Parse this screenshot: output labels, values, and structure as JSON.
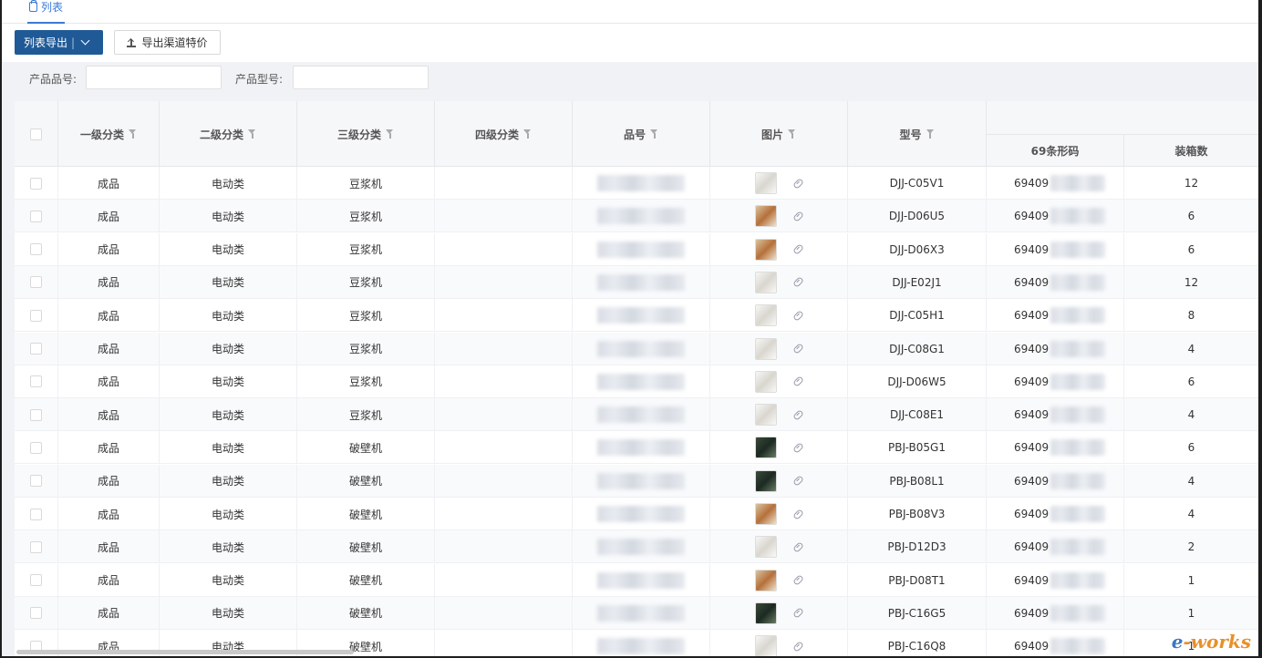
{
  "tab": {
    "label": "列表"
  },
  "toolbar": {
    "export_list": "列表导出",
    "export_channel_price": "导出渠道特价"
  },
  "filters": {
    "product_no_label": "产品品号:",
    "product_no_value": "",
    "model_label": "产品型号:",
    "model_value": ""
  },
  "columns": {
    "level1": "一级分类",
    "level2": "二级分类",
    "level3": "三级分类",
    "level4": "四级分类",
    "product_no": "品号",
    "image": "图片",
    "model": "型号",
    "barcode": "69条形码",
    "pack_qty": "装箱数"
  },
  "rows": [
    {
      "l1": "成品",
      "l2": "电动类",
      "l3": "豆浆机",
      "l4": "",
      "model": "DJJ-C05V1",
      "barcode": "69409",
      "qty": "12"
    },
    {
      "l1": "成品",
      "l2": "电动类",
      "l3": "豆浆机",
      "l4": "",
      "model": "DJJ-D06U5",
      "barcode": "69409",
      "qty": "6"
    },
    {
      "l1": "成品",
      "l2": "电动类",
      "l3": "豆浆机",
      "l4": "",
      "model": "DJJ-D06X3",
      "barcode": "69409",
      "qty": "6"
    },
    {
      "l1": "成品",
      "l2": "电动类",
      "l3": "豆浆机",
      "l4": "",
      "model": "DJJ-E02J1",
      "barcode": "69409",
      "qty": "12"
    },
    {
      "l1": "成品",
      "l2": "电动类",
      "l3": "豆浆机",
      "l4": "",
      "model": "DJJ-C05H1",
      "barcode": "69409",
      "qty": "8"
    },
    {
      "l1": "成品",
      "l2": "电动类",
      "l3": "豆浆机",
      "l4": "",
      "model": "DJJ-C08G1",
      "barcode": "69409",
      "qty": "4"
    },
    {
      "l1": "成品",
      "l2": "电动类",
      "l3": "豆浆机",
      "l4": "",
      "model": "DJJ-D06W5",
      "barcode": "69409",
      "qty": "6"
    },
    {
      "l1": "成品",
      "l2": "电动类",
      "l3": "豆浆机",
      "l4": "",
      "model": "DJJ-C08E1",
      "barcode": "69409",
      "qty": "4"
    },
    {
      "l1": "成品",
      "l2": "电动类",
      "l3": "破壁机",
      "l4": "",
      "model": "PBJ-B05G1",
      "barcode": "69409",
      "qty": "6"
    },
    {
      "l1": "成品",
      "l2": "电动类",
      "l3": "破壁机",
      "l4": "",
      "model": "PBJ-B08L1",
      "barcode": "69409",
      "qty": "4"
    },
    {
      "l1": "成品",
      "l2": "电动类",
      "l3": "破壁机",
      "l4": "",
      "model": "PBJ-B08V3",
      "barcode": "69409",
      "qty": "4"
    },
    {
      "l1": "成品",
      "l2": "电动类",
      "l3": "破壁机",
      "l4": "",
      "model": "PBJ-D12D3",
      "barcode": "69409",
      "qty": "2"
    },
    {
      "l1": "成品",
      "l2": "电动类",
      "l3": "破壁机",
      "l4": "",
      "model": "PBJ-D08T1",
      "barcode": "69409",
      "qty": "1"
    },
    {
      "l1": "成品",
      "l2": "电动类",
      "l3": "破壁机",
      "l4": "",
      "model": "PBJ-C16G5",
      "barcode": "69409",
      "qty": "1"
    },
    {
      "l1": "成品",
      "l2": "电动类",
      "l3": "破壁机",
      "l4": "",
      "model": "PBJ-C16Q8",
      "barcode": "69409",
      "qty": "1"
    }
  ],
  "thumb_styles": [
    "light",
    "warm",
    "warm",
    "light",
    "light",
    "light",
    "light",
    "light",
    "dark",
    "dark",
    "warm",
    "light",
    "warm",
    "dark",
    "light"
  ],
  "watermark": {
    "e": "e",
    "rest": "-works"
  },
  "colors": {
    "accent": "#1f5a96",
    "tab_active": "#3a7bd5"
  }
}
